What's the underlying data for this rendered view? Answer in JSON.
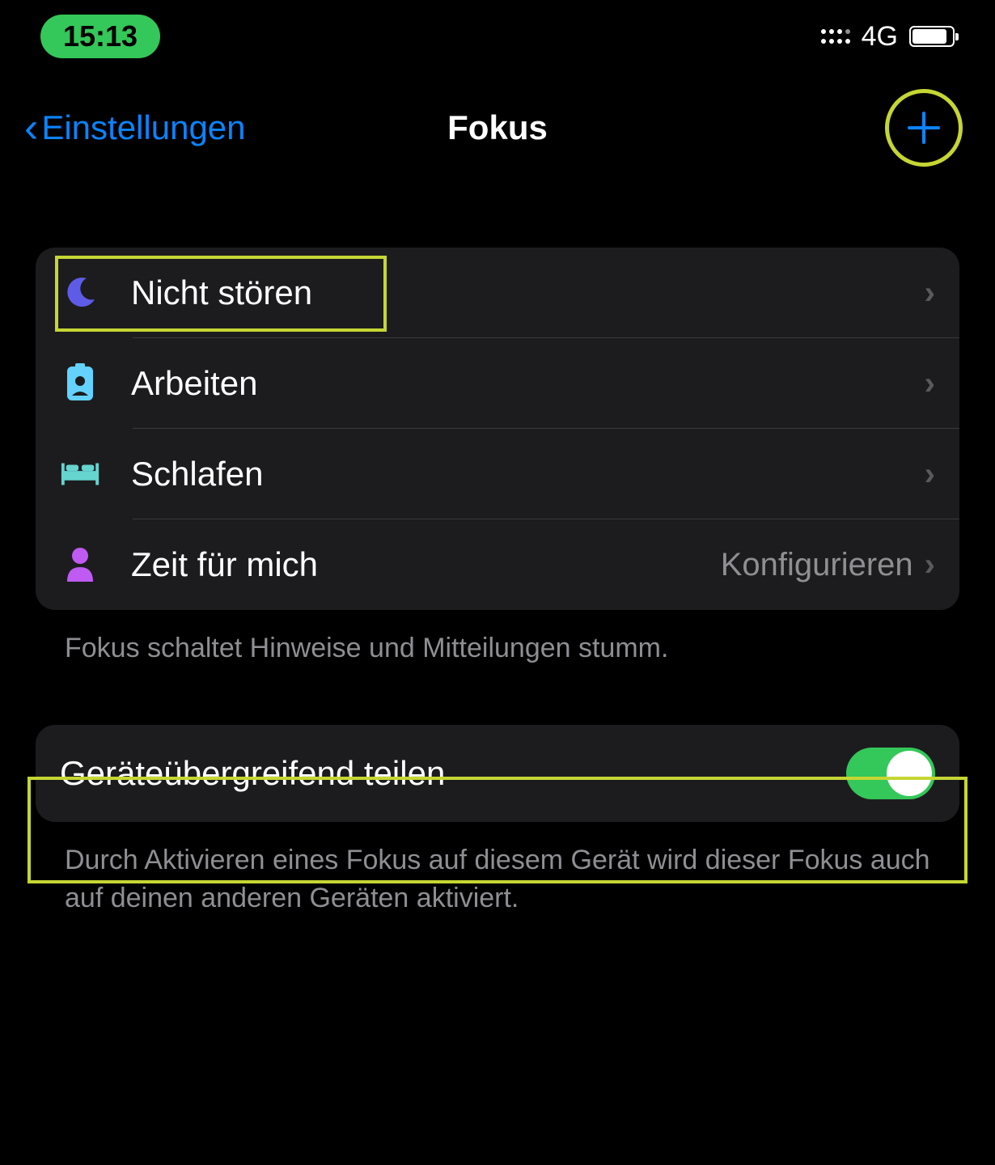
{
  "status": {
    "time": "15:13",
    "cellular": "4G"
  },
  "nav": {
    "back_label": "Einstellungen",
    "title": "Fokus"
  },
  "focus_modes": [
    {
      "label": "Nicht stören",
      "detail": "",
      "icon": "moon",
      "icon_color": "#5e5ce6"
    },
    {
      "label": "Arbeiten",
      "detail": "",
      "icon": "badge",
      "icon_color": "#64d2ff"
    },
    {
      "label": "Schlafen",
      "detail": "",
      "icon": "bed",
      "icon_color": "#66d4cf"
    },
    {
      "label": "Zeit für mich",
      "detail": "Konfigurieren",
      "icon": "person",
      "icon_color": "#bf5af2"
    }
  ],
  "footer_1": "Fokus schaltet Hinweise und Mitteilungen stumm.",
  "share": {
    "label": "Geräteübergreifend teilen",
    "enabled": true
  },
  "footer_2": "Durch Aktivieren eines Fokus auf diesem Gerät wird dieser Fokus auch auf deinen anderen Geräten aktiviert."
}
